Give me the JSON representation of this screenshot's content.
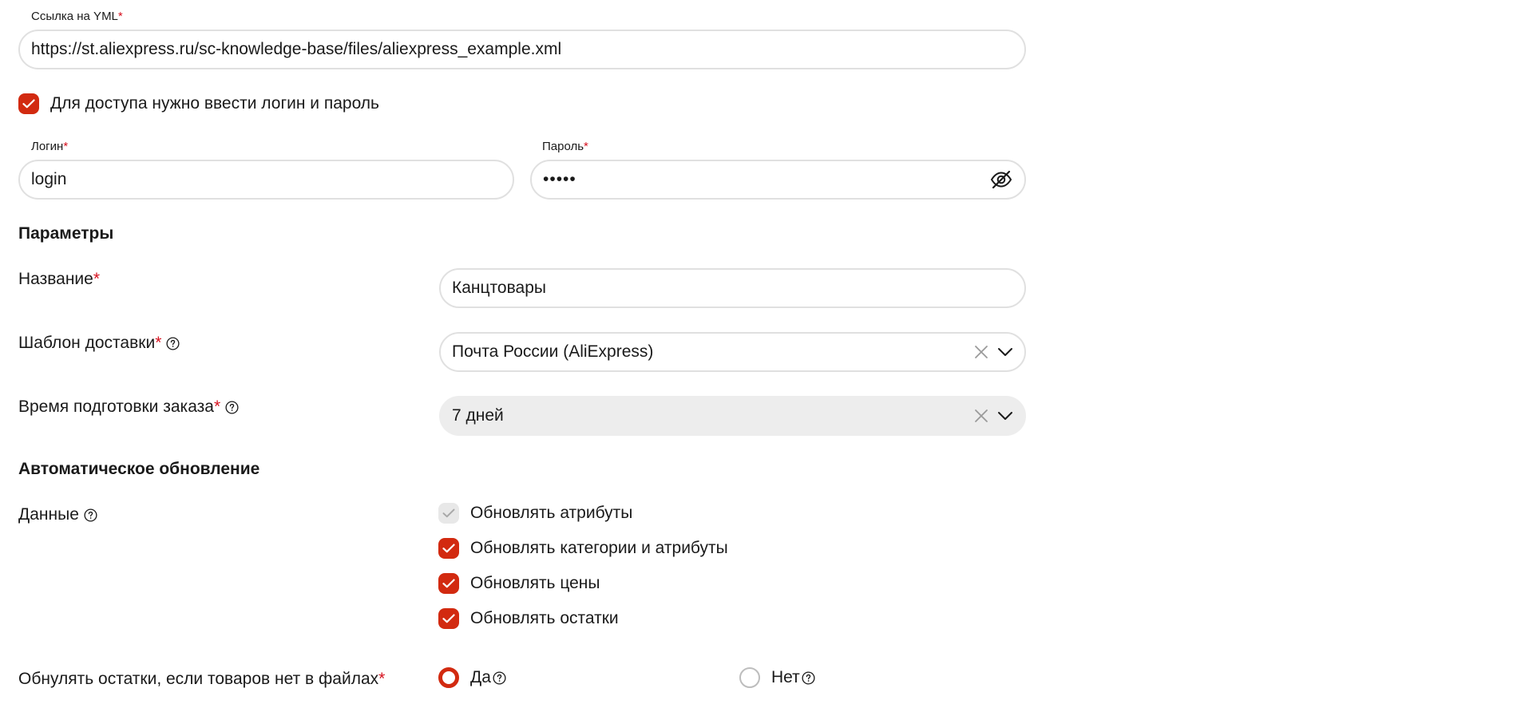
{
  "yml": {
    "label": "Ссылка на YML",
    "required_mark": "*",
    "value": "https://st.aliexpress.ru/sc-knowledge-base/files/aliexpress_example.xml"
  },
  "auth_checkbox": {
    "label": "Для доступа нужно ввести логин и пароль",
    "checked": true
  },
  "login": {
    "label": "Логин",
    "required_mark": "*",
    "value": "login"
  },
  "password": {
    "label": "Пароль",
    "required_mark": "*",
    "value": "•••••",
    "toggle_icon": "eye-off-icon"
  },
  "params": {
    "heading": "Параметры",
    "name": {
      "label": "Название",
      "required_mark": "*",
      "value": "Канцтовары"
    },
    "delivery": {
      "label": "Шаблон доставки",
      "required_mark": "*",
      "value": "Почта России (AliExpress)"
    },
    "prep_time": {
      "label": "Время подготовки заказа",
      "required_mark": "*",
      "value": "7 дней"
    }
  },
  "auto_update": {
    "heading": "Автоматическое обновление",
    "data_label": "Данные",
    "options": [
      {
        "label": "Обновлять атрибуты",
        "checked": true,
        "disabled": true
      },
      {
        "label": "Обновлять категории и атрибуты",
        "checked": true,
        "disabled": false
      },
      {
        "label": "Обновлять цены",
        "checked": true,
        "disabled": false
      },
      {
        "label": "Обновлять остатки",
        "checked": true,
        "disabled": false
      }
    ]
  },
  "reset_stock": {
    "label": "Обнулять остатки, если товаров нет в файлах",
    "required_mark": "*",
    "yes": "Да",
    "no": "Нет",
    "selected": "Да"
  },
  "colors": {
    "accent": "#d22a10",
    "required": "#d6121f",
    "border": "#e0e0e0",
    "disabled_bg": "#ededed"
  }
}
